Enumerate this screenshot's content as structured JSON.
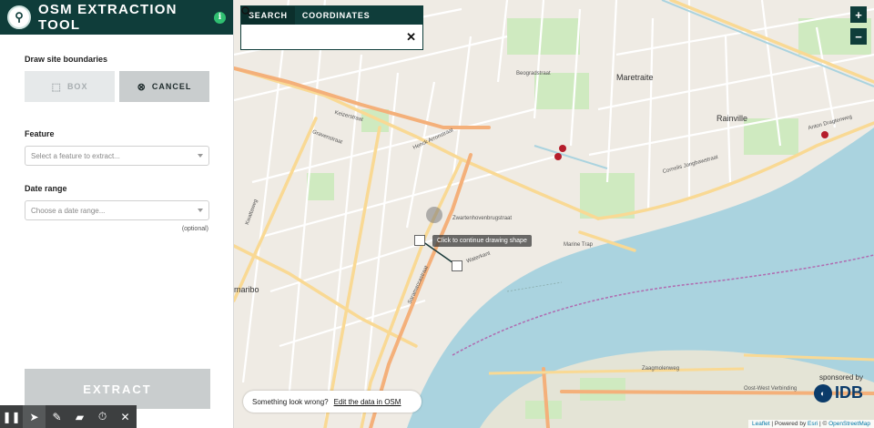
{
  "app": {
    "title": "OSM EXTRACTION TOOL",
    "info_icon": "info-icon"
  },
  "draw": {
    "label": "Draw site boundaries",
    "box_label": "BOX",
    "cancel_label": "CANCEL"
  },
  "feature": {
    "label": "Feature",
    "placeholder": "Select a feature to extract..."
  },
  "date_range": {
    "label": "Date range",
    "placeholder": "Choose a date range...",
    "hint": "(optional)"
  },
  "extract_label": "EXTRACT",
  "tools": [
    "pause-icon",
    "pointer-icon",
    "pencil-icon",
    "eraser-icon",
    "timer-icon",
    "close-icon"
  ],
  "search": {
    "tabs": [
      "SEARCH",
      "COORDINATES"
    ],
    "active_tab": "SEARCH",
    "value": ""
  },
  "zoom": {
    "in": "+",
    "out": "−"
  },
  "map": {
    "tooltip": "Click to continue drawing shape",
    "labels": {
      "maretraite": "Maretraite",
      "rainville": "Rainville",
      "paramaribo": "maribo",
      "marine_trap": "Marine Trap",
      "waterkant": "Waterkant",
      "henck": "Henck Arronstraat",
      "keizer": "Keizerstraat",
      "gravenstraat": "Gravenstraat",
      "anton": "Anton Dragtenweg",
      "cornelis": "Cornelis Jongbawstraat",
      "zwartenhovenbrug": "Zwartenhovenbrugstraat",
      "verbinding": "Oost-West Verbinding",
      "zaagmolen": "Zaagmolenweg",
      "saramacca": "Saramaccastraat",
      "kwattaweg": "Kwattaweg",
      "beograd": "Beogradstraat"
    }
  },
  "feedback": {
    "text": "Something look wrong?",
    "link": "Edit the data in OSM"
  },
  "sponsor": {
    "label": "sponsored by",
    "brand": "IDB"
  },
  "attribution": {
    "leaflet": "Leaflet",
    "sep1": " | Powered by ",
    "esri": "Esri",
    "sep2": " | © ",
    "osm": "OpenStreetMap"
  }
}
